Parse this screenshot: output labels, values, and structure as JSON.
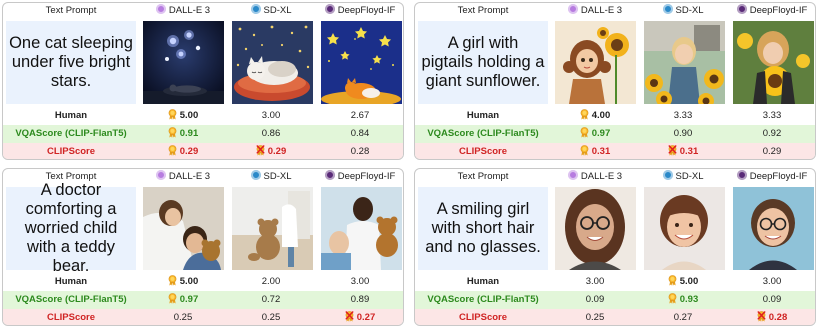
{
  "header": {
    "text_prompt": "Text Prompt",
    "models": [
      "DALL-E 3",
      "SD-XL",
      "DeepFloyd-IF"
    ]
  },
  "row_labels": [
    "Human",
    "VQAScore (CLIP-FlanT5)",
    "CLIPScore"
  ],
  "colors": {
    "prompt_bg": "#eaf2fd",
    "vqa_row": "#e2f6d9",
    "clip_row": "#fce6e6",
    "vqa_text": "#2d8a1e",
    "clip_text": "#d02424"
  },
  "panels": [
    {
      "prompt": "One cat sleeping under five bright stars.",
      "scores": {
        "human": [
          "5.00",
          "3.00",
          "2.67"
        ],
        "vqa": [
          "0.91",
          "0.86",
          "0.84"
        ],
        "clip": [
          "0.29",
          "0.29",
          "0.28"
        ]
      },
      "marks": {
        "human": [
          "medal",
          "",
          ""
        ],
        "vqa": [
          "medal",
          "",
          ""
        ],
        "clip": [
          "medal",
          "cross",
          ""
        ]
      },
      "images": [
        "night-sky-cat",
        "cat-on-cushion",
        "fox-under-stars"
      ]
    },
    {
      "prompt": "A girl with pigtails holding a giant sunflower.",
      "scores": {
        "human": [
          "4.00",
          "3.33",
          "3.33"
        ],
        "vqa": [
          "0.97",
          "0.90",
          "0.92"
        ],
        "clip": [
          "0.31",
          "0.31",
          "0.29"
        ]
      },
      "marks": {
        "human": [
          "medal",
          "",
          ""
        ],
        "vqa": [
          "medal",
          "",
          ""
        ],
        "clip": [
          "medal",
          "cross",
          ""
        ]
      },
      "images": [
        "cartoon-girl-sunflower",
        "girl-in-sunflower-field",
        "girl-holding-sunflower"
      ]
    },
    {
      "prompt": "A doctor comforting a worried child with a teddy bear.",
      "scores": {
        "human": [
          "5.00",
          "2.00",
          "3.00"
        ],
        "vqa": [
          "0.97",
          "0.72",
          "0.89"
        ],
        "clip": [
          "0.25",
          "0.25",
          "0.27"
        ]
      },
      "marks": {
        "human": [
          "medal",
          "",
          ""
        ],
        "vqa": [
          "medal",
          "",
          ""
        ],
        "clip": [
          "",
          "",
          "cross"
        ]
      },
      "images": [
        "doctor-hugging-child",
        "teddy-on-floor",
        "child-with-teddy"
      ]
    },
    {
      "prompt": "A smiling girl with short hair and no glasses.",
      "scores": {
        "human": [
          "3.00",
          "5.00",
          "3.00"
        ],
        "vqa": [
          "0.09",
          "0.93",
          "0.09"
        ],
        "clip": [
          "0.25",
          "0.27",
          "0.28"
        ]
      },
      "marks": {
        "human": [
          "",
          "medal",
          ""
        ],
        "vqa": [
          "",
          "medal",
          ""
        ],
        "clip": [
          "",
          "",
          "cross"
        ]
      },
      "images": [
        "girl-with-glasses",
        "girl-short-hair",
        "woman-with-glasses"
      ]
    }
  ]
}
